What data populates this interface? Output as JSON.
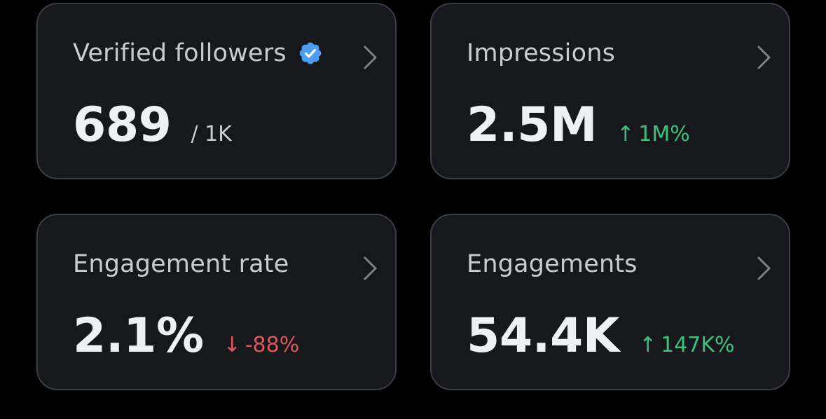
{
  "colors": {
    "background": "#000000",
    "card": "#17181c",
    "card_border": "#3a3d44",
    "verified": "#4a9ff5",
    "positive": "#3fbf7f",
    "negative": "#e0565b"
  },
  "cards": [
    {
      "title": "Verified followers",
      "icon": "verified-badge-icon",
      "value": "689",
      "sub": "/ 1K"
    },
    {
      "title": "Impressions",
      "value": "2.5M",
      "delta_arrow": "↑",
      "delta": "1M%",
      "delta_direction": "up"
    },
    {
      "title": "Engagement rate",
      "value": "2.1%",
      "delta_arrow": "↓",
      "delta": "-88%",
      "delta_direction": "down"
    },
    {
      "title": "Engagements",
      "value": "54.4K",
      "delta_arrow": "↑",
      "delta": "147K%",
      "delta_direction": "up"
    }
  ]
}
